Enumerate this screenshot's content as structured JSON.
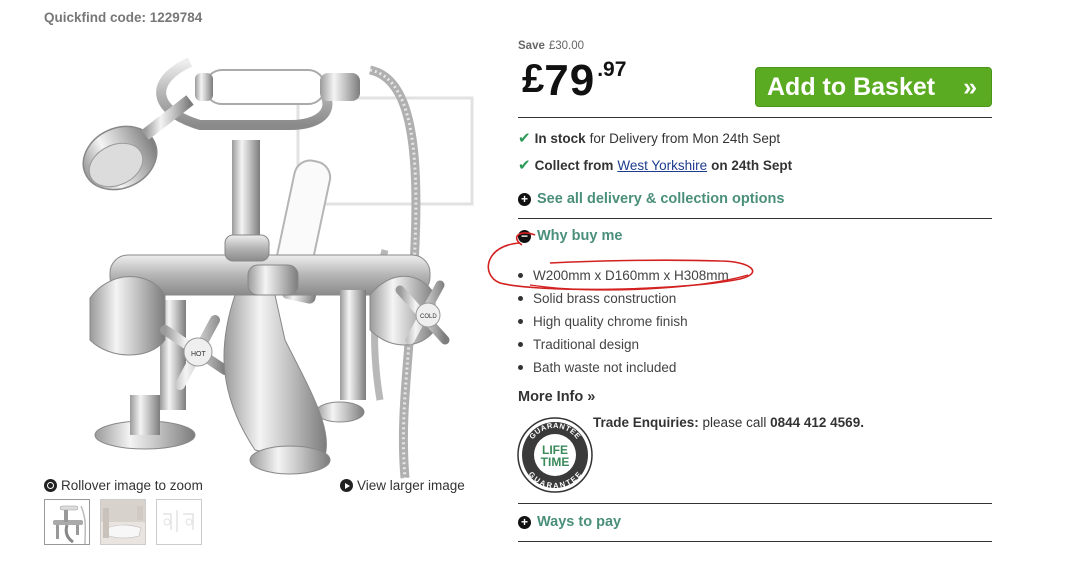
{
  "quickfind": "Quickfind code: 1229784",
  "gallery": {
    "rollover_label": "Rollover image to zoom",
    "view_larger_label": "View larger image",
    "thumbnails": [
      "thumb-1",
      "thumb-2",
      "thumb-3"
    ],
    "badges": {
      "hot": "HOT",
      "cold": "COLD"
    }
  },
  "pricing": {
    "save_label": "Save",
    "save_amount": "£30.00",
    "currency": "£",
    "pounds": "79",
    "pence": ".97"
  },
  "basket": {
    "label": "Add to Basket",
    "arrow": "»"
  },
  "delivery": {
    "in_stock": "In stock",
    "in_stock_detail": "for Delivery from Mon 24th Sept",
    "collect_prefix": "Collect from",
    "collect_location": "West Yorkshire",
    "collect_suffix": "on 24th Sept",
    "options_link": "See all delivery & collection options"
  },
  "why_buy": {
    "heading": "Why buy me",
    "bullets": [
      "W200mm x D160mm x H308mm",
      "Solid brass construction",
      "High quality chrome finish",
      "Traditional design",
      "Bath waste not included"
    ]
  },
  "more_info": "More Info »",
  "guarantee": {
    "top": "GUARANTEE",
    "line1": "LIFE",
    "line2": "TIME",
    "bottom": "GUARANTEE"
  },
  "trade": {
    "label": "Trade Enquiries:",
    "text": "please call",
    "phone": "0844 412 4569."
  },
  "ways_to_pay": "Ways to pay",
  "colors": {
    "accent_green": "#5aab22",
    "link_teal": "#4a8f7a",
    "annotation_red": "#d32020"
  }
}
